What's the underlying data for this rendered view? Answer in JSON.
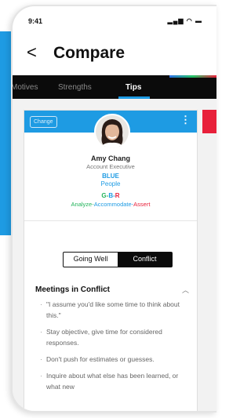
{
  "status": {
    "time": "9:41",
    "icons": "signal-icon wifi-icon battery-icon"
  },
  "header": {
    "title": "Compare"
  },
  "tabs": [
    {
      "label": "Motives"
    },
    {
      "label": "Strengths"
    },
    {
      "label": "Tips"
    }
  ],
  "card": {
    "change_label": "Change",
    "name": "Amy Chang",
    "role": "Account Executive",
    "color": "BLUE",
    "motive": "People",
    "gbr": {
      "g": "G",
      "b": "B",
      "r": "R",
      "sep": "-"
    },
    "styles": {
      "g": "Analyze",
      "b": "Accommodate",
      "r": "Assert",
      "sep": "-"
    }
  },
  "segment": {
    "left": "Going Well",
    "right": "Conflict"
  },
  "section": {
    "title": "Meetings in Conflict",
    "tips": [
      "\"I assume you'd like some time to think about this.\"",
      "Stay objective, give time for considered responses.",
      "Don't push for estimates or guesses.",
      "Inquire about what else has been learned, or what new"
    ]
  },
  "colors": {
    "blue": "#1e9be3",
    "green": "#22b35a",
    "red": "#e8203a",
    "black": "#0b0b0b"
  }
}
